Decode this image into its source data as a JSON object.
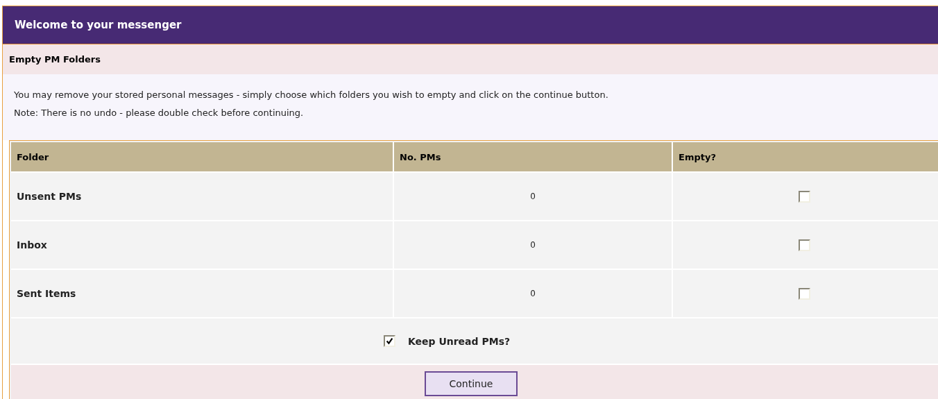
{
  "title": "Welcome to your messenger",
  "section": {
    "title": "Empty PM Folders",
    "description": [
      "You may remove your stored personal messages - simply choose which folders you wish to empty and click on the continue button.",
      "Note: There is no undo - please double check before continuing."
    ]
  },
  "table": {
    "columns": [
      "Folder",
      "No. PMs",
      "Empty?"
    ],
    "rows": [
      {
        "folder": "Unsent PMs",
        "count": "0",
        "checked": false
      },
      {
        "folder": "Inbox",
        "count": "0",
        "checked": false
      },
      {
        "folder": "Sent Items",
        "count": "0",
        "checked": false
      }
    ]
  },
  "keep_unread": {
    "label": "Keep Unread PMs?",
    "checked": true
  },
  "buttons": [
    "Continue"
  ]
}
